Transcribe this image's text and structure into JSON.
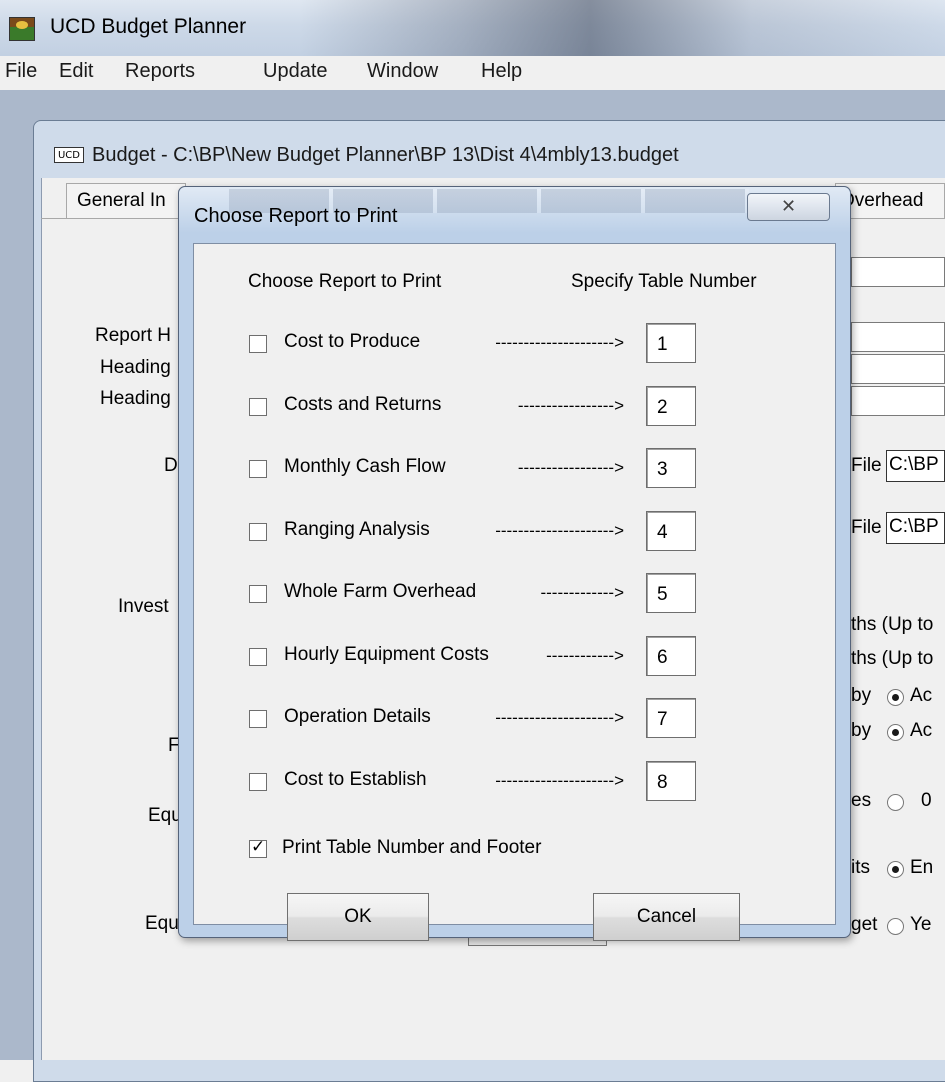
{
  "app": {
    "title": "UCD Budget Planner"
  },
  "menu": [
    "File",
    "Edit",
    "Reports",
    "Update",
    "Window",
    "Help"
  ],
  "child_window": {
    "icon_text": "UCD",
    "title": "Budget - C:\\BP\\New Budget Planner\\BP 13\\Dist 4\\4mbly13.budget",
    "tabs": {
      "first": "General In",
      "last": "Overhead"
    }
  },
  "background": {
    "labels": [
      "Report H",
      "Heading",
      "Heading",
      "D",
      "Invest",
      "F",
      "Equ",
      "Equ"
    ],
    "file_label": "File",
    "file_path": "C:\\BP",
    "right_texts": [
      "ths (Up to",
      "ths (Up to",
      "by",
      "by",
      "es",
      "its",
      "get"
    ],
    "radio_texts": [
      "Ac",
      "Ac",
      "0",
      "En",
      "Ye"
    ]
  },
  "dialog": {
    "title": "Choose Report to Print",
    "close_symbol": "✕",
    "col_header_left": "Choose Report to Print",
    "col_header_right": "Specify Table Number",
    "reports": [
      {
        "label": "Cost to Produce",
        "arrow": "--------------------->",
        "number": "1",
        "checked": false
      },
      {
        "label": "Costs and Returns",
        "arrow": "----------------->",
        "number": "2",
        "checked": false
      },
      {
        "label": "Monthly Cash Flow",
        "arrow": "----------------->",
        "number": "3",
        "checked": false
      },
      {
        "label": "Ranging Analysis",
        "arrow": "--------------------->",
        "number": "4",
        "checked": false
      },
      {
        "label": "Whole Farm Overhead",
        "arrow": "------------->",
        "number": "5",
        "checked": false
      },
      {
        "label": "Hourly Equipment Costs",
        "arrow": "------------>",
        "number": "6",
        "checked": false
      },
      {
        "label": "Operation Details",
        "arrow": "--------------------->",
        "number": "7",
        "checked": false
      },
      {
        "label": "Cost to Establish",
        "arrow": "--------------------->",
        "number": "8",
        "checked": false
      }
    ],
    "footer_option": {
      "label": "Print Table Number and Footer",
      "checked": true
    },
    "ok_label": "OK",
    "cancel_label": "Cancel"
  }
}
